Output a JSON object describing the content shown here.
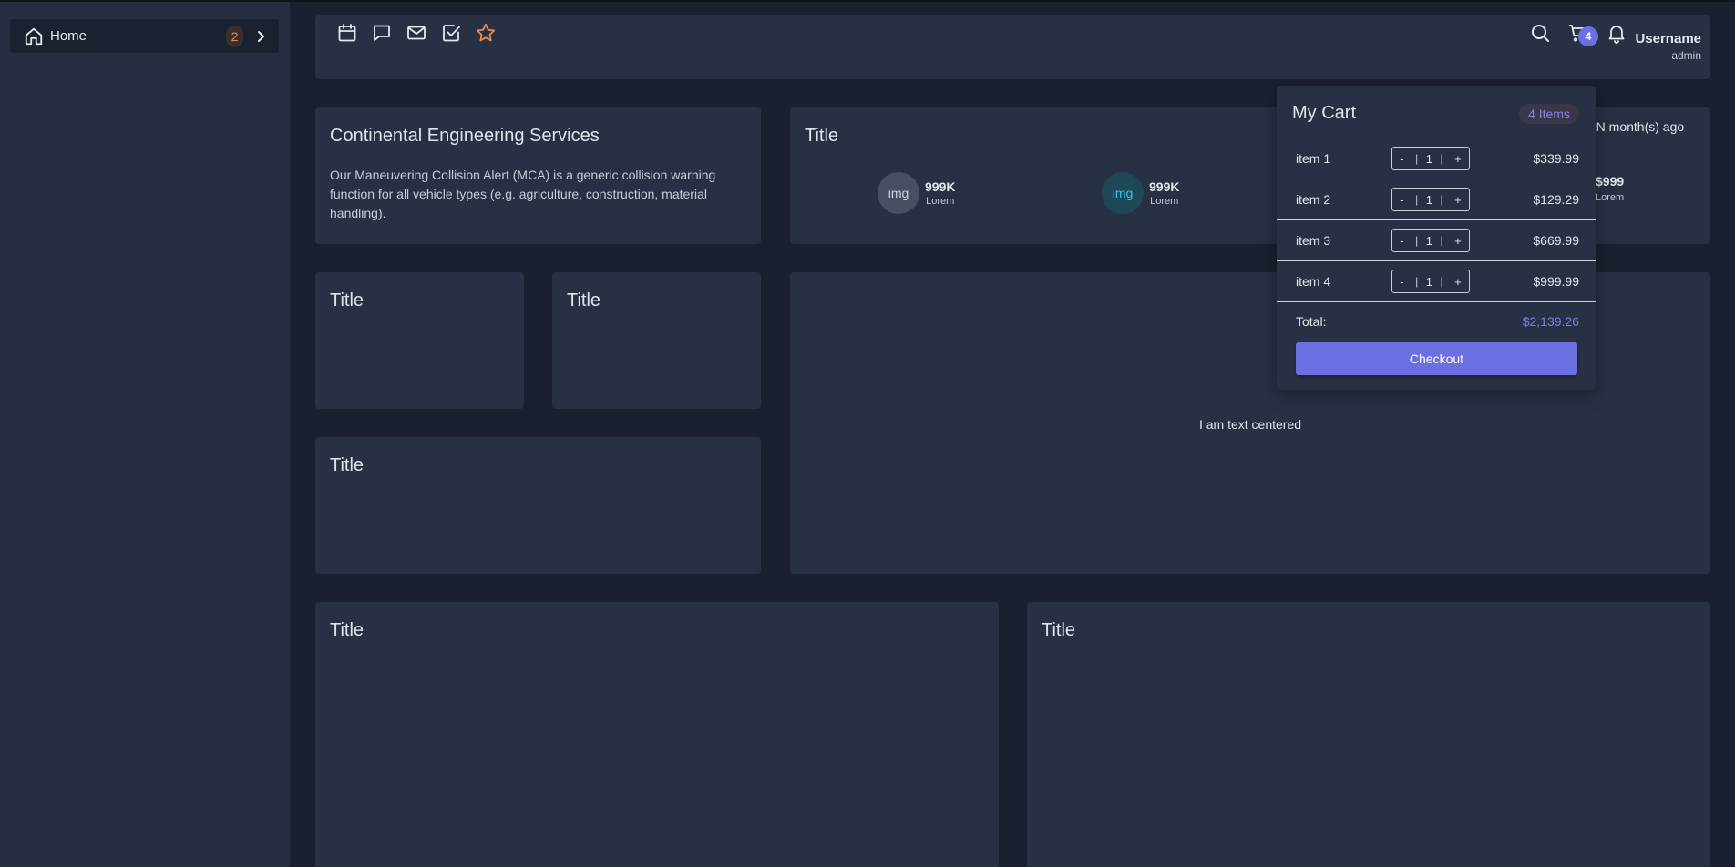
{
  "sidebar": {
    "home_label": "Home",
    "home_badge": "2"
  },
  "header": {
    "icons": [
      "calendar-icon",
      "chat-icon",
      "mail-icon",
      "checkbox-icon",
      "star-icon",
      "search-icon",
      "cart-icon",
      "bell-icon"
    ],
    "cart_badge": "4",
    "username": "Username",
    "role": "admin"
  },
  "company_card": {
    "title": "Continental Engineering Services",
    "description": "Our Maneuvering Collision Alert (MCA) is a generic collision warning function for all vehicle types (e.g. agriculture, construction, material handling)."
  },
  "stats_card": {
    "title": "Title",
    "partial_time": "e N month(s) ago",
    "stats": [
      {
        "img": "img",
        "value": "999K",
        "label": "Lorem"
      },
      {
        "img": "img",
        "value": "999K",
        "label": "Lorem"
      }
    ],
    "partial_value": "$999",
    "partial_label": "Lorem"
  },
  "cards": {
    "small_left_title": "Title",
    "small_right_title": "Title",
    "medium_title": "Title",
    "bottom_left_title": "Title",
    "bottom_right_title": "Title",
    "centered_text": "I am text centered"
  },
  "cart": {
    "title": "My Cart",
    "count_label": "4 Items",
    "items": [
      {
        "name": "item 1",
        "qty": "1",
        "price": "$339.99"
      },
      {
        "name": "item 2",
        "qty": "1",
        "price": "$129.29"
      },
      {
        "name": "item 3",
        "qty": "1",
        "price": "$669.99"
      },
      {
        "name": "item 4",
        "qty": "1",
        "price": "$999.99"
      }
    ],
    "minus": "-",
    "plus": "+",
    "total_label": "Total:",
    "total_value": "$2,139.26",
    "checkout_label": "Checkout"
  },
  "colors": {
    "accent": "#6b6fe2",
    "star": "#f08a4b",
    "background": "#1a2030",
    "card": "#283044"
  }
}
